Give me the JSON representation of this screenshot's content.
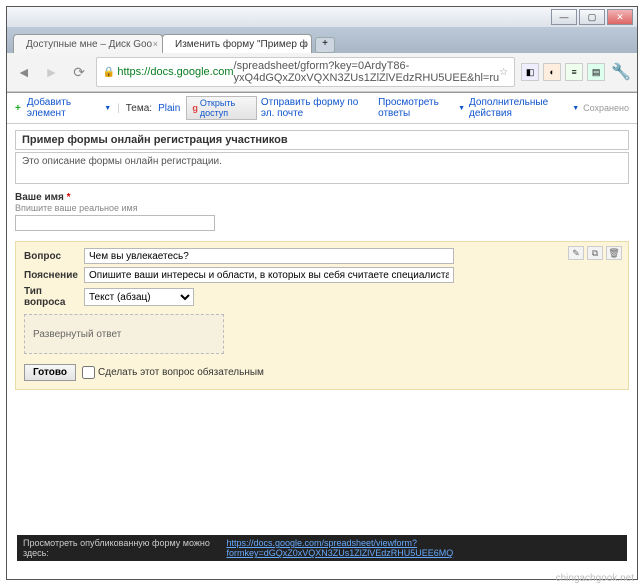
{
  "window": {
    "minimize": "—",
    "maximize": "▢",
    "close": "✕"
  },
  "tabs": [
    {
      "title": "Доступные мне – Диск Goo",
      "active": false
    },
    {
      "title": "Изменить форму \"Пример ф",
      "active": true
    }
  ],
  "address": {
    "scheme": "https",
    "host": "://docs.google.com",
    "path": "/spreadsheet/gform?key=0ArdyT86-yxQ4dGQxZ0xVQXN3ZUs1ZlZlVEdzRHU5UEE&hl=ru"
  },
  "toolbar": {
    "add_element": "Добавить элемент",
    "theme_label": "Тема:",
    "theme_value": "Plain",
    "share": "Открыть доступ",
    "send_email": "Отправить форму по эл. почте",
    "view_responses": "Просмотреть ответы",
    "more_actions": "Дополнительные действия",
    "saved": "Сохранено"
  },
  "form": {
    "title": "Пример формы онлайн регистрация участников",
    "description": "Это описание формы онлайн регистрации."
  },
  "field1": {
    "label": "Ваше имя",
    "required_mark": "*",
    "hint": "Впишите ваше реальное имя"
  },
  "question": {
    "row_question": "Вопрос",
    "row_help": "Пояснение",
    "row_type": "Тип вопроса",
    "question_value": "Чем вы увлекаетесь?",
    "help_value": "Опишите ваши интересы и области, в которых вы себя считаете специалистами",
    "type_value": "Текст (абзац)",
    "preview_text": "Развернутый ответ",
    "done": "Готово",
    "required_label": "Сделать этот вопрос обязательным"
  },
  "footer": {
    "text": "Просмотреть опубликованную форму можно здесь: ",
    "link": "https://docs.google.com/spreadsheet/viewform?formkey=dGQxZ0xVQXN3ZUs1ZlZlVEdzRHU5UEE6MQ"
  },
  "watermark": "chingachgook.net"
}
